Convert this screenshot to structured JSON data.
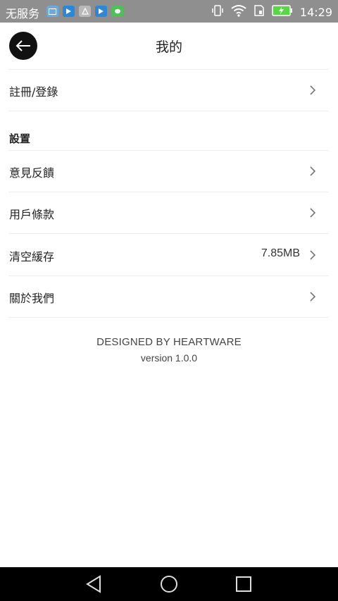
{
  "status_bar": {
    "carrier": "无服务",
    "time": "14:29",
    "notifications": [
      "message-icon",
      "play-icon",
      "app-icon",
      "play-icon",
      "chat-icon"
    ]
  },
  "header": {
    "title": "我的",
    "back_icon": "arrow-left-icon"
  },
  "account": {
    "register_login": "註冊/登錄"
  },
  "settings": {
    "section_title": "設置",
    "items": [
      {
        "label": "意見反饋",
        "value": ""
      },
      {
        "label": "用戶條款",
        "value": ""
      },
      {
        "label": "清空緩存",
        "value": "7.85MB"
      },
      {
        "label": "關於我們",
        "value": ""
      }
    ]
  },
  "footer": {
    "brand": "DESIGNED BY HEARTWARE",
    "version": "version 1.0.0"
  },
  "nav_bar": {
    "buttons": [
      "back-triangle-icon",
      "home-circle-icon",
      "recents-square-icon"
    ]
  },
  "colors": {
    "status_bar_bg": "#8f8f8f",
    "nav_bar_bg": "#000000",
    "divider": "#eeeeee",
    "battery_green": "#5bd34a"
  }
}
